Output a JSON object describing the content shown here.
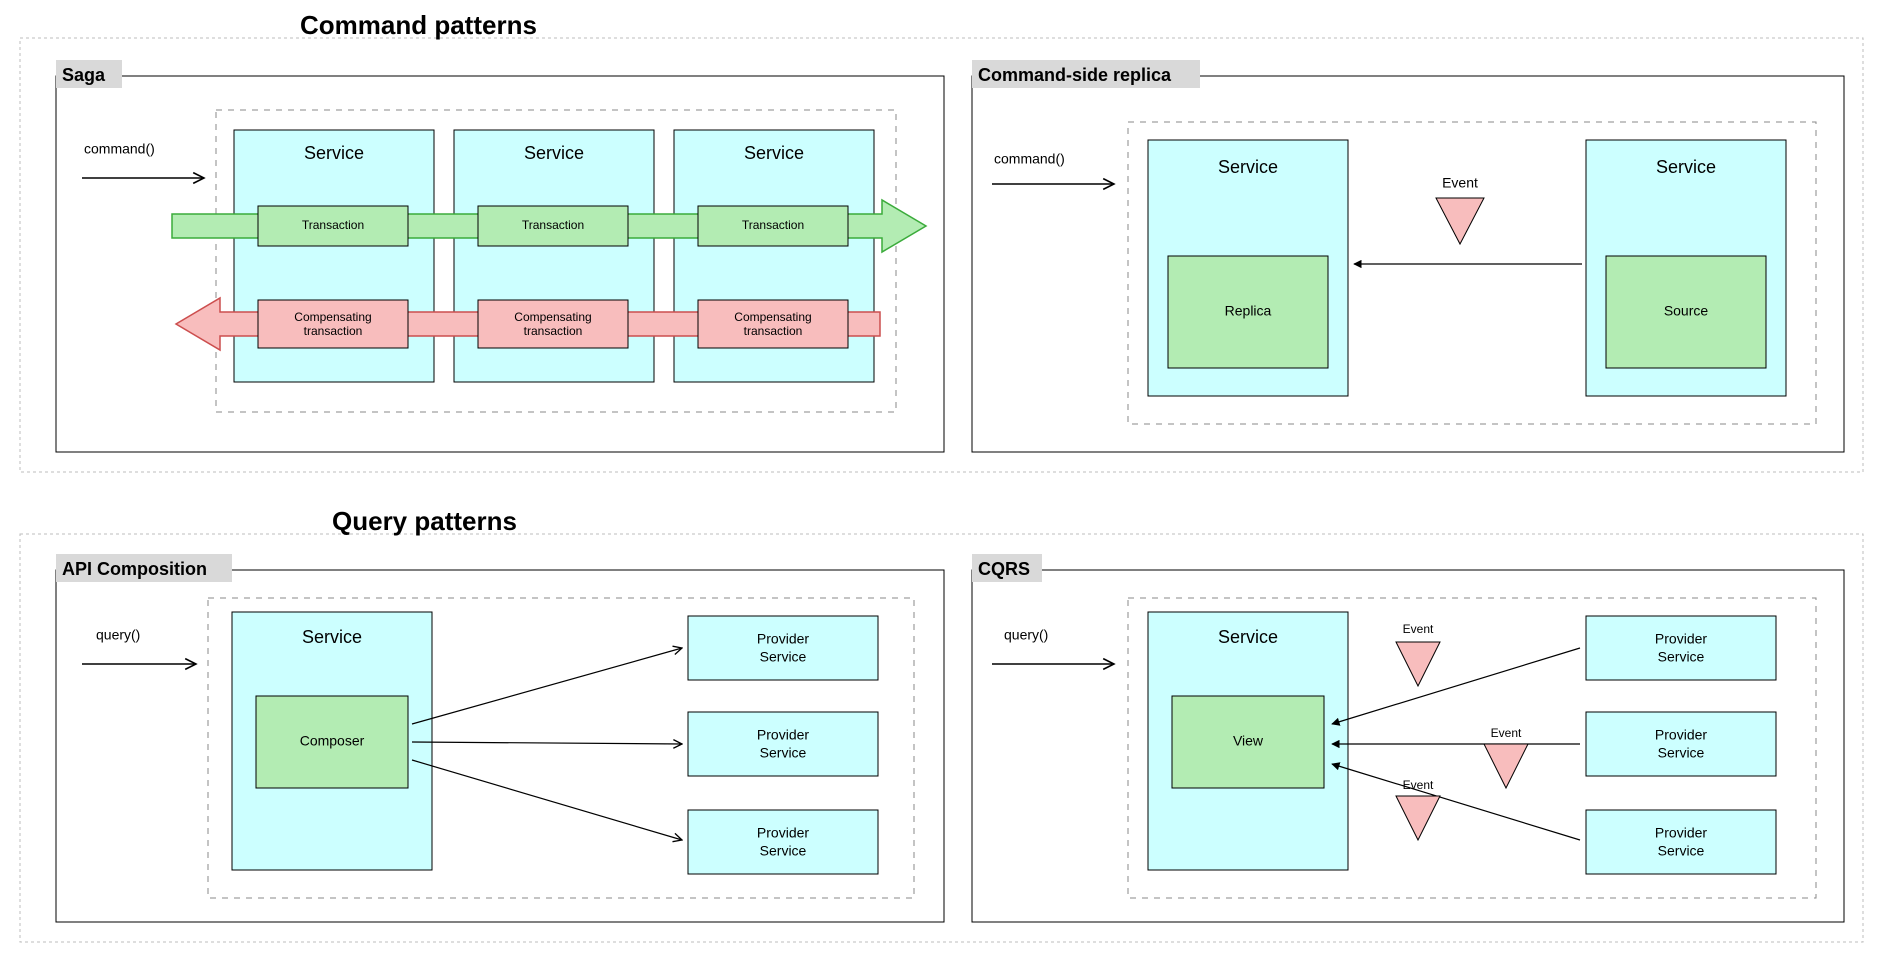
{
  "sections": {
    "command": "Command patterns",
    "query": "Query patterns"
  },
  "panels": {
    "saga": "Saga",
    "replica": "Command-side replica",
    "api": "API Composition",
    "cqrs": "CQRS"
  },
  "calls": {
    "command": "command()",
    "query": "query()"
  },
  "common": {
    "service": "Service",
    "provider_service": "Provider Service",
    "event": "Event"
  },
  "saga": {
    "transaction": "Transaction",
    "compensating": "Compensating transaction"
  },
  "replica": {
    "replica": "Replica",
    "source": "Source"
  },
  "api": {
    "composer": "Composer"
  },
  "cqrs": {
    "view": "View"
  }
}
